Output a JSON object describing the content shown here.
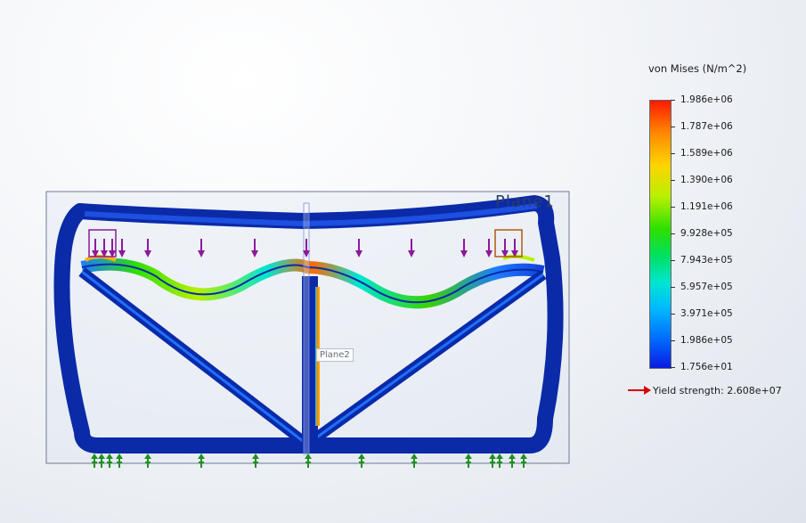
{
  "legend": {
    "title": "von Mises (N/m^2)",
    "labels": [
      "1.986e+06",
      "1.787e+06",
      "1.589e+06",
      "1.390e+06",
      "1.191e+06",
      "9.928e+05",
      "7.943e+05",
      "5.957e+05",
      "3.971e+05",
      "1.986e+05",
      "1.756e+01"
    ],
    "max_color": "#ff1a00",
    "min_color": "#0a1ae0"
  },
  "yield": {
    "text": "Yield strength: 2.608e+07",
    "arrow_color": "#d80000"
  },
  "planes": {
    "plane1": "Plane1",
    "plane2": "Plane2"
  },
  "colors": {
    "structure_base": "#0a2aa8",
    "load_arrow": "#8a1a9a",
    "fixture_arrow": "#1f8f1f",
    "accent_load": "#b05a10"
  }
}
